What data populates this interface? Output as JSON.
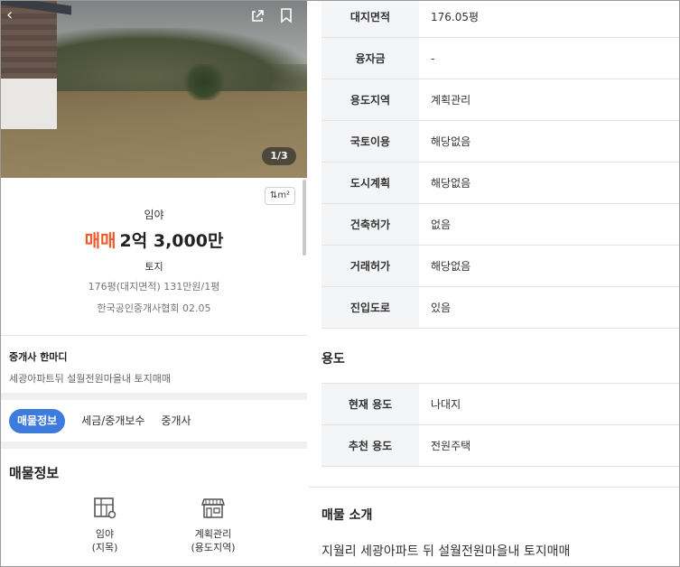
{
  "left": {
    "photo_counter": "1/3",
    "unit_toggle": "m²",
    "property_type": "임야",
    "deal_type": "매매",
    "price": "2억 3,000만",
    "category": "토지",
    "sub_info": "176평(대지면적)  131만원/1평",
    "agency": "한국공인중개사협회 02.05",
    "comment": {
      "title": "중개사 한마디",
      "text": "세광아파트뒤 설월전원마을내 토지매매"
    },
    "tabs": [
      {
        "label": "매물정보",
        "active": true
      },
      {
        "label": "세금/중개보수",
        "active": false
      },
      {
        "label": "중개사",
        "active": false
      }
    ],
    "section_title": "매물정보",
    "features": [
      {
        "icon": "land-map-icon",
        "line1": "임야",
        "line2": "(지목)"
      },
      {
        "icon": "store-icon",
        "line1": "계획관리",
        "line2": "(용도지역)"
      }
    ]
  },
  "right": {
    "details": [
      {
        "label": "대지면적",
        "value": "176.05평"
      },
      {
        "label": "융자금",
        "value": "-"
      },
      {
        "label": "용도지역",
        "value": "계획관리"
      },
      {
        "label": "국토이용",
        "value": "해당없음"
      },
      {
        "label": "도시계획",
        "value": "해당없음"
      },
      {
        "label": "건축허가",
        "value": "없음"
      },
      {
        "label": "거래허가",
        "value": "해당없음"
      },
      {
        "label": "진입도로",
        "value": "있음"
      }
    ],
    "usage_heading": "용도",
    "usage": [
      {
        "label": "현재 용도",
        "value": "나대지"
      },
      {
        "label": "추천 용도",
        "value": "전원주택"
      }
    ],
    "intro_heading": "매물 소개",
    "intro_text": "지월리 세광아파트 뒤 설월전원마을내 토지매매"
  },
  "colors": {
    "deal_accent": "#f05a28",
    "tab_active": "#3d7bdc",
    "label_bg": "#f4f5f7"
  }
}
